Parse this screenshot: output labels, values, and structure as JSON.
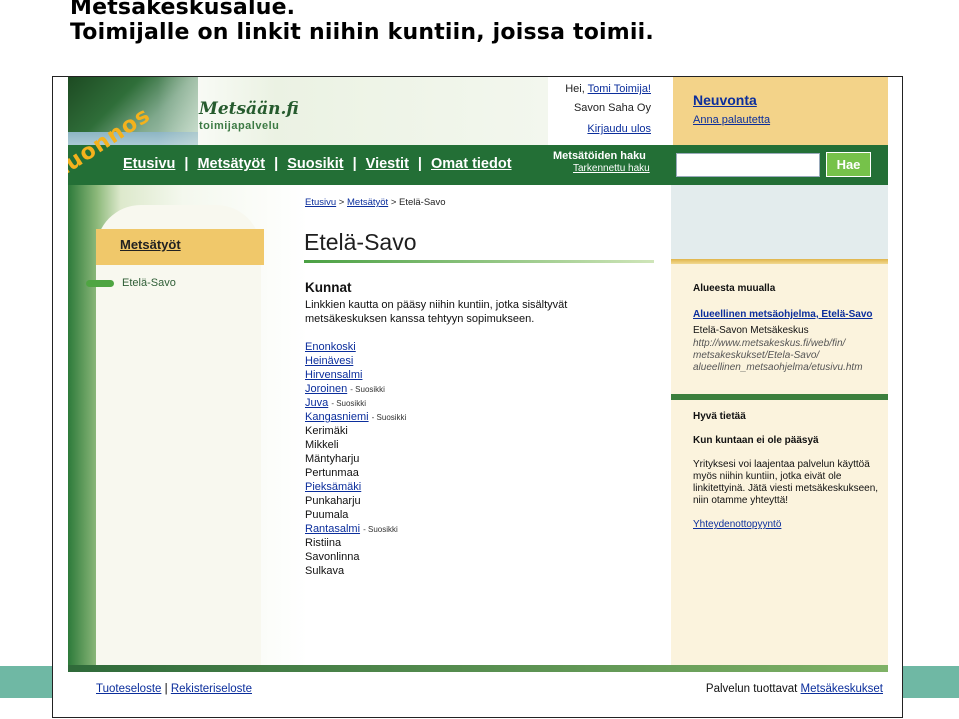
{
  "slide": {
    "title_line1": "Metsäkeskusalue.",
    "title_line2": "Toimijalle on linkit niihin kuntiin, joissa toimii."
  },
  "header": {
    "logo_main": "Metsään.fi",
    "logo_sub": "toimijapalvelu",
    "watermark": "Luonnos",
    "greeting": "Hei,",
    "user_name": "Tomi Toimija!",
    "company": "Savon Saha Oy",
    "logout": "Kirjaudu ulos",
    "neuvonta": "Neuvonta",
    "feedback": "Anna palautetta"
  },
  "nav": {
    "items": [
      "Etusivu",
      "Metsätyöt",
      "Suosikit",
      "Viestit",
      "Omat tiedot"
    ],
    "search_title": "Metsätöiden haku",
    "advanced_search": "Tarkennettu haku",
    "search_value": "",
    "search_button": "Hae"
  },
  "sidebar": {
    "heading": "Metsätyöt",
    "item": "Etelä-Savo"
  },
  "main": {
    "breadcrumb": {
      "home": "Etusivu",
      "sep1": ">",
      "section": "Metsätyöt",
      "sep2": ">",
      "current": "Etelä-Savo"
    },
    "title": "Etelä-Savo",
    "section_title": "Kunnat",
    "description": "Linkkien kautta on pääsy niihin kuntiin, jotka sisältyvät metsäkeskuksen kanssa tehtyyn sopimukseen.",
    "municipalities": [
      {
        "name": "Enonkoski",
        "link": true,
        "tag": ""
      },
      {
        "name": "Heinävesi",
        "link": true,
        "tag": ""
      },
      {
        "name": "Hirvensalmi",
        "link": true,
        "tag": ""
      },
      {
        "name": "Joroinen",
        "link": true,
        "tag": "- Suosikki"
      },
      {
        "name": "Juva",
        "link": true,
        "tag": "- Suosikki"
      },
      {
        "name": "Kangasniemi",
        "link": true,
        "tag": "- Suosikki"
      },
      {
        "name": "Kerimäki",
        "link": false,
        "tag": ""
      },
      {
        "name": "Mikkeli",
        "link": false,
        "tag": ""
      },
      {
        "name": "Mäntyharju",
        "link": false,
        "tag": ""
      },
      {
        "name": "Pertunmaa",
        "link": false,
        "tag": ""
      },
      {
        "name": "Pieksämäki",
        "link": true,
        "tag": ""
      },
      {
        "name": "Punkaharju",
        "link": false,
        "tag": ""
      },
      {
        "name": "Puumala",
        "link": false,
        "tag": ""
      },
      {
        "name": "Rantasalmi",
        "link": true,
        "tag": "- Suosikki"
      },
      {
        "name": "Ristiina",
        "link": false,
        "tag": ""
      },
      {
        "name": "Savonlinna",
        "link": false,
        "tag": ""
      },
      {
        "name": "Sulkava",
        "link": false,
        "tag": ""
      }
    ]
  },
  "right": {
    "elsewhere_title": "Alueesta muualla",
    "program_link": "Alueellinen metsäohjelma, Etelä-Savo",
    "center_name": "Etelä-Savon Metsäkeskus",
    "url_line1": "http://www.metsakeskus.fi/web/fin/",
    "url_line2": "metsakeskukset/Etela-Savo/",
    "url_line3": "alueellinen_metsaohjelma/etusivu.htm",
    "good_title": "Hyvä tietää",
    "question": "Kun kuntaan ei ole pääsyä",
    "info_line1": "Yrityksesi voi laajentaa palvelun käyttöä",
    "info_line2": "myös niihin kuntiin, jotka eivät ole",
    "info_line3": "linkitettyinä. Jätä viesti metsäkeskukseen,",
    "info_line4": "niin otamme yhteyttä!",
    "contact_link": "Yhteydenottopyyntö"
  },
  "footer": {
    "product": "Tuoteseloste",
    "sep": "|",
    "register": "Rekisteriseloste",
    "provider_prefix": "Palvelun tuottavat",
    "provider_link": "Metsäkeskukset"
  },
  "colors": {
    "nav_green": "#236f36",
    "accent_yellow": "#f3d389",
    "link_blue": "#0b2e9c",
    "watermark_orange": "#f4b21d",
    "slide_teal": "#6fb8a4"
  }
}
